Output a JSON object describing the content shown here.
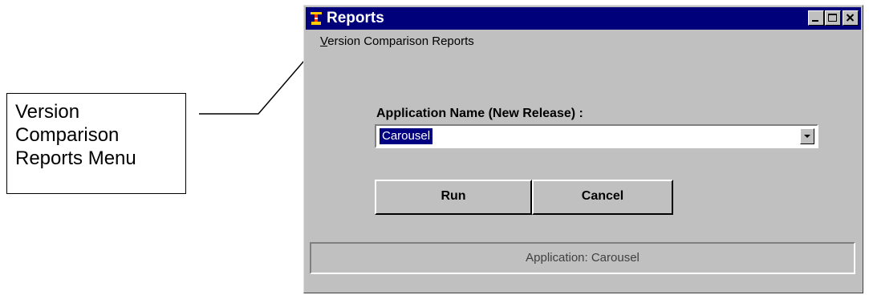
{
  "callout": {
    "lines": [
      "Version",
      "Comparison",
      "Reports Menu"
    ]
  },
  "window": {
    "title": "Reports",
    "app_icon": "app-icon",
    "controls": [
      "minimize-icon",
      "maximize-icon",
      "close-icon"
    ]
  },
  "menu": {
    "items": [
      {
        "mnemonic": "V",
        "rest": "ersion Comparison Reports"
      }
    ]
  },
  "form": {
    "application_label": "Application Name (New Release) :",
    "application_value": "Carousel",
    "dropdown_icon": "chevron-down-icon"
  },
  "buttons": {
    "run_label": "Run",
    "cancel_label": "Cancel"
  },
  "status": {
    "text": "Application: Carousel"
  },
  "colors": {
    "titlebar": "#00007b",
    "face": "#c0c0c0",
    "selection": "#000080"
  }
}
